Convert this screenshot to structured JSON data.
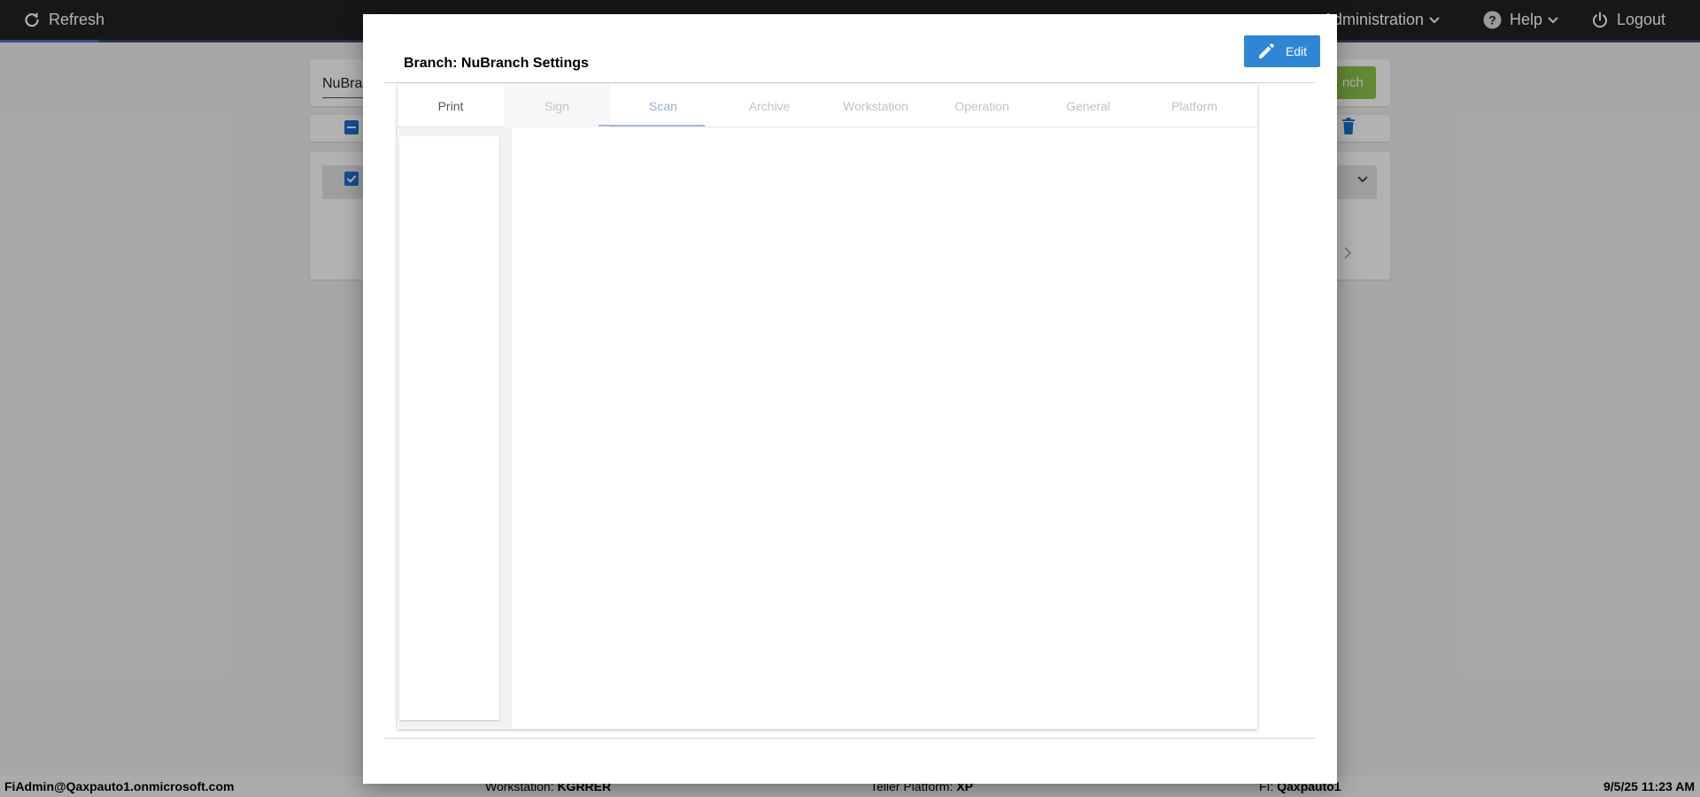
{
  "topbar": {
    "refresh_label": "Refresh",
    "administration_label": "Administration",
    "help_label": "Help",
    "logout_label": "Logout"
  },
  "background": {
    "search_value": "NuBra",
    "add_button_label": "nch"
  },
  "footer": {
    "user": "FiAdmin@Qaxpauto1.onmicrosoft.com",
    "workstation_label": "Workstation:",
    "workstation_value": "KGRRER",
    "teller_label": "Teller Platform:",
    "teller_value": "XP",
    "fi_label": "FI:",
    "fi_value": "Qaxpauto1",
    "datetime": "9/5/25 11:23 AM"
  },
  "modal": {
    "title": "Branch: NuBranch Settings",
    "edit_label": "Edit",
    "tabs": [
      "Print",
      "Sign",
      "Scan",
      "Archive",
      "Workstation",
      "Operation",
      "General",
      "Platform"
    ],
    "active_tab": "Scan"
  },
  "colors": {
    "navbar": "#222222",
    "edit_button": "#2f86d6",
    "add_button": "#8bc34a",
    "checkbox": "#1e6fd1"
  }
}
